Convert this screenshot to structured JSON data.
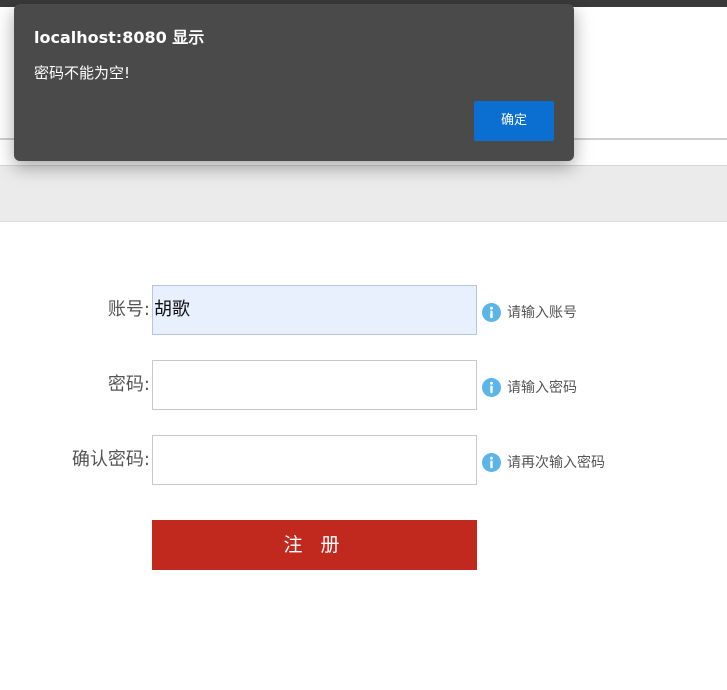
{
  "dialog": {
    "title": "localhost:8080 显示",
    "message": "密码不能为空!",
    "ok_label": "确定",
    "ok_color": "#0a6fd1"
  },
  "form": {
    "account": {
      "label": "账号:",
      "value": "胡歌",
      "hint": "请输入账号"
    },
    "password": {
      "label": "密码:",
      "value": "",
      "hint": "请输入密码"
    },
    "confirm_password": {
      "label": "确认密码:",
      "value": "",
      "hint": "请再次输入密码"
    },
    "submit_label": "注 册",
    "submit_color": "#c1291f"
  },
  "icons": {
    "hint_icon": "info-icon",
    "hint_icon_color": "#5bb5e8"
  }
}
